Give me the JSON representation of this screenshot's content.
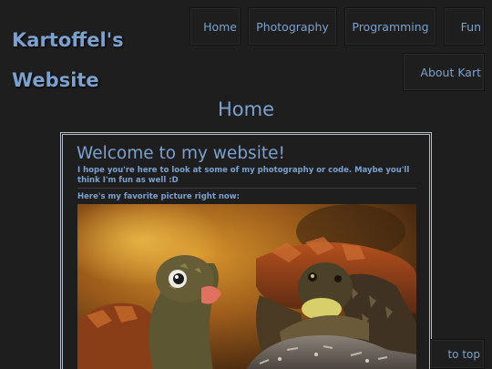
{
  "site": {
    "title": "Kartoffel's Website"
  },
  "nav": {
    "home": "Home",
    "photography": "Photography",
    "programming": "Programming",
    "fun": "Fun",
    "about": "About Kart"
  },
  "page": {
    "heading": "Home"
  },
  "card": {
    "title": "Welcome to my website!",
    "intro": "I hope you're here to look at some of my photography or code. Maybe you'll think I'm fun as well :D",
    "favorite_label": "Here's my favorite picture right now:"
  },
  "footer": {
    "to_top": "to top"
  },
  "colors": {
    "background": "#1e1e1e",
    "accent": "#7ba1cf",
    "card_border": "#b4bcc8"
  }
}
